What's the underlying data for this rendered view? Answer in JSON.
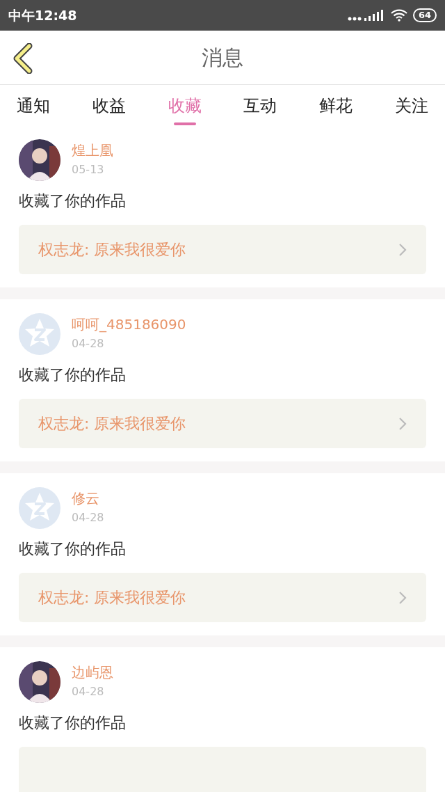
{
  "status_bar": {
    "time": "中午12:48",
    "battery": "64"
  },
  "header": {
    "title": "消息"
  },
  "tabs": [
    {
      "label": "通知",
      "selected": false
    },
    {
      "label": "收益",
      "selected": false
    },
    {
      "label": "收藏",
      "selected": true
    },
    {
      "label": "互动",
      "selected": false
    },
    {
      "label": "鲜花",
      "selected": false
    },
    {
      "label": "关注",
      "selected": false
    }
  ],
  "messages": [
    {
      "user": "煌上凰",
      "date": "05-13",
      "text": "收藏了你的作品",
      "work": "权志龙: 原来我很爱你"
    },
    {
      "avatar": {
        "kind": "default"
      },
      "user": "呵呵_485186090",
      "date": "04-28",
      "text": "收藏了你的作品",
      "work": "权志龙: 原来我很爱你"
    },
    {
      "avatar": {
        "kind": "default"
      },
      "user": "修云",
      "date": "04-28",
      "text": "收藏了你的作品",
      "work": "权志龙: 原来我很爱你"
    },
    {
      "user": "边屿恩",
      "date": "04-28",
      "text": "收藏了你的作品"
    }
  ]
}
